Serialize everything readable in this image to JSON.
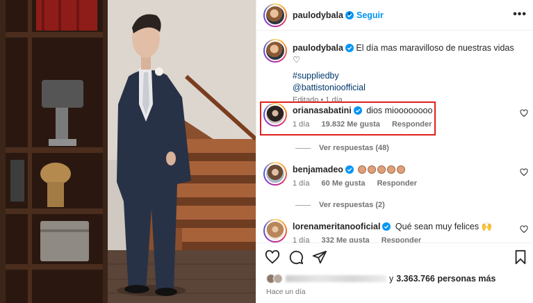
{
  "header": {
    "username": "paulodybala",
    "separator": "•",
    "follow_label": "Seguir",
    "more_label": "•••"
  },
  "caption": {
    "username": "paulodybala",
    "text": "El día mas maravilloso de nuestras vidas ♡",
    "hashtag": "#suppliedby",
    "mention": "@battistonioofficial",
    "meta": "Editado • 1 día"
  },
  "comments": [
    {
      "username": "orianasabatini",
      "text": "dios mioooooooo",
      "time": "1 día",
      "likes": "19.832 Me gusta",
      "reply": "Responder",
      "view_replies": "Ver respuestas (48)"
    },
    {
      "username": "benjamadeo",
      "text": "",
      "emoji_count": 5,
      "time": "1 día",
      "likes": "60 Me gusta",
      "reply": "Responder",
      "view_replies": "Ver respuestas (2)"
    },
    {
      "username": "lorenameritanooficial",
      "text": "Qué sean muy felices 🙌",
      "time": "1 día",
      "likes": "332 Me gusta",
      "reply": "Responder"
    }
  ],
  "actions": {
    "like_icon": "heart-icon",
    "comment_icon": "comment-icon",
    "share_icon": "share-icon",
    "save_icon": "bookmark-icon"
  },
  "likes_summary": {
    "prefix": "y",
    "count": "3.363.766 personas más"
  },
  "timestamp": "Hace un día",
  "colors": {
    "accent": "#0095f6",
    "link": "#00376b",
    "highlight": "#e0201c",
    "meta": "#737373"
  }
}
